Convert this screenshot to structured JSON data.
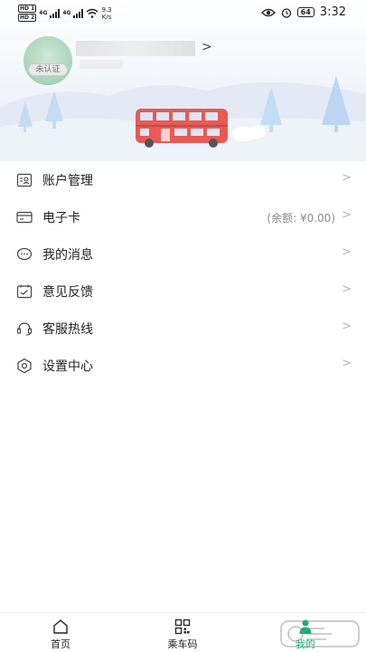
{
  "status_bar": {
    "network_1": "4G",
    "network_2": "4G",
    "speed_value": "9.3",
    "speed_unit": "K/s",
    "battery": "64",
    "time": "3:32"
  },
  "profile": {
    "cert_status": "未认证",
    "arrow": ">"
  },
  "menu": {
    "items": [
      {
        "label": "账户管理",
        "icon": "account-icon",
        "extra": ""
      },
      {
        "label": "电子卡",
        "icon": "card-icon",
        "extra": "(余额: ¥0.00)"
      },
      {
        "label": "我的消息",
        "icon": "message-icon",
        "extra": ""
      },
      {
        "label": "意见反馈",
        "icon": "feedback-icon",
        "extra": ""
      },
      {
        "label": "客服热线",
        "icon": "headset-icon",
        "extra": ""
      },
      {
        "label": "设置中心",
        "icon": "settings-icon",
        "extra": ""
      }
    ],
    "arrow": ">"
  },
  "tabbar": {
    "tabs": [
      {
        "label": "首页",
        "icon": "home-icon"
      },
      {
        "label": "乘车码",
        "icon": "qr-code-icon"
      },
      {
        "label": "我的",
        "icon": "profile-icon"
      }
    ],
    "active_index": 2
  },
  "colors": {
    "accent": "#1aab7a",
    "bus": "#e85a55",
    "tree": "#bcd6f3"
  }
}
